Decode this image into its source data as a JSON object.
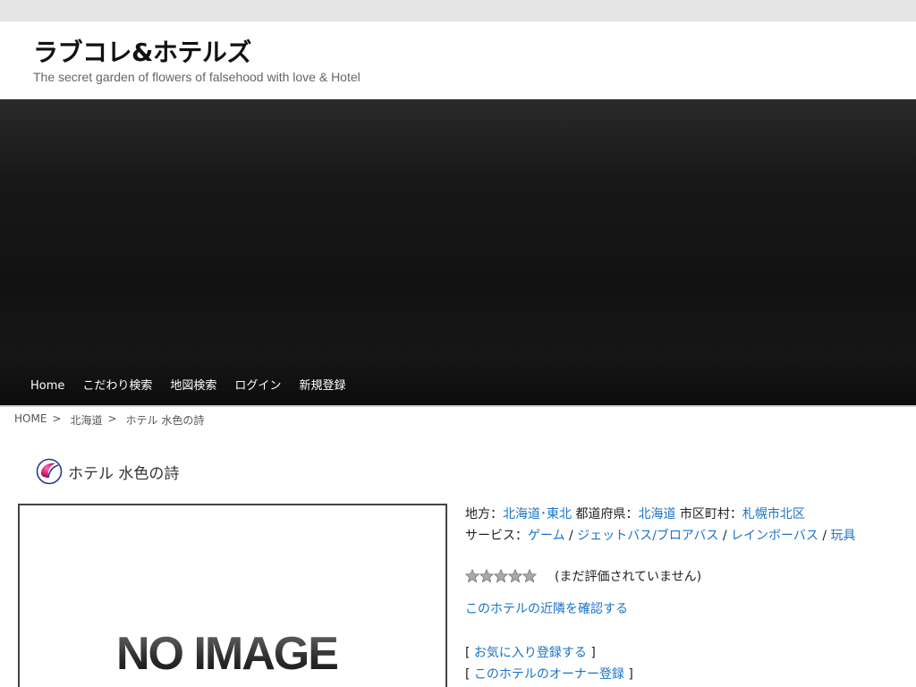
{
  "site": {
    "title": "ラブコレ&ホテルズ",
    "description": "The secret garden of flowers of falsehood with love & Hotel"
  },
  "nav": {
    "items": [
      "Home",
      "こだわり検索",
      "地図検索",
      "ログイン",
      "新規登録"
    ]
  },
  "breadcrumb": {
    "home": "HOME",
    "region": "北海道",
    "current": "ホテル 水色の詩",
    "separator": ">"
  },
  "hotel": {
    "name": "ホテル 水色の詩",
    "photo_placeholder": "NO IMAGE",
    "area_label": "地方：",
    "area": "北海道･東北",
    "prefecture_label": "都道府県：",
    "prefecture": "北海道",
    "city_label": "市区町村：",
    "city": "札幌市北区",
    "services_label": "サービス：",
    "services": [
      "ゲーム",
      "ジェットバス/ブロアバス",
      "レインボーバス",
      "玩具"
    ],
    "service_separator": "/",
    "rating_count": 5,
    "rating_value": 0,
    "rating_text": "(まだ評価されていません)",
    "nearby_link": "このホテルの近隣を確認する",
    "favorite_link": "お気に入り登録する",
    "owner_link": "このホテルのオーナー登録",
    "bracket_open": "[",
    "bracket_close": "]"
  },
  "colors": {
    "link": "#1a73c8",
    "hero_dark": "#121212",
    "topbar": "#e4e4e4"
  }
}
